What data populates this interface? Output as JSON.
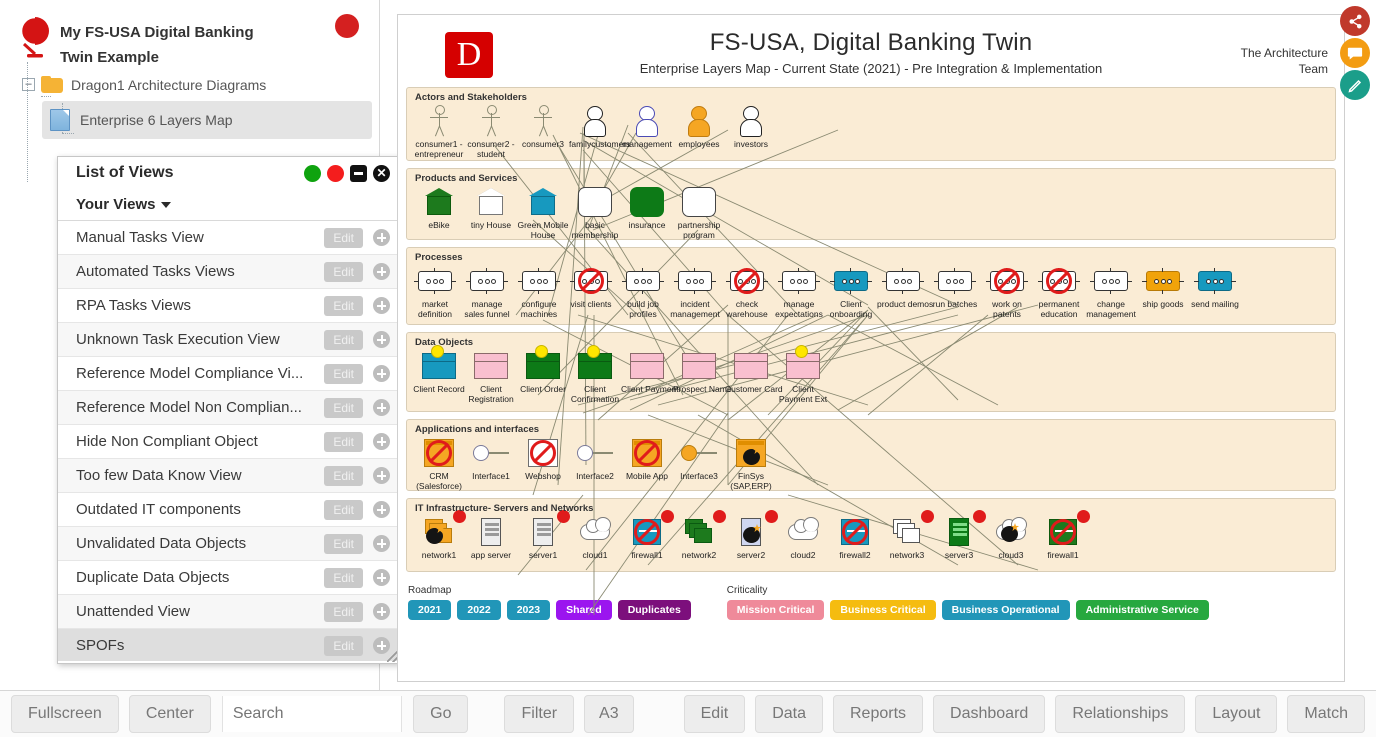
{
  "tree": {
    "root_label": "My FS-USA Digital Banking Twin Example",
    "globe_icon": "globe-icon",
    "folder_label": "Dragon1 Architecture Diagrams",
    "folder_icon": "folder-icon",
    "expander_glyph": "–",
    "doc_label": "Enterprise 6 Layers Map",
    "doc_icon": "document-icon"
  },
  "views_window": {
    "title": "List of Views",
    "subtitle": "Your Views",
    "controls": {
      "green": "green-dot",
      "red": "red-dot",
      "minimize": "minimize",
      "close": "✕"
    },
    "edit_label": "Edit",
    "add_label": "+",
    "items": [
      {
        "label": "Manual Tasks View",
        "selected": false
      },
      {
        "label": "Automated Tasks Views",
        "selected": false
      },
      {
        "label": "RPA Tasks Views",
        "selected": false
      },
      {
        "label": "Unknown Task Execution View",
        "selected": false
      },
      {
        "label": "Reference Model Compliance Vi...",
        "selected": false
      },
      {
        "label": "Reference Model Non Complian...",
        "selected": false
      },
      {
        "label": "Hide Non Compliant Object",
        "selected": false
      },
      {
        "label": "Too few Data Know View",
        "selected": false
      },
      {
        "label": "Outdated IT components",
        "selected": false
      },
      {
        "label": "Unvalidated Data Objects",
        "selected": false
      },
      {
        "label": "Duplicate Data Objects",
        "selected": false
      },
      {
        "label": "Unattended View",
        "selected": false
      },
      {
        "label": "SPOFs",
        "selected": true
      }
    ]
  },
  "diagram": {
    "logo_letter": "D",
    "title": "FS-USA, Digital Banking Twin",
    "subtitle": "Enterprise Layers Map - Current State (2021) - Pre Integration & Implementation",
    "team": "The Architecture Team",
    "bands": [
      {
        "label": "Actors and Stakeholders",
        "nodes": [
          {
            "caption": "consumer1 - entrepreneur",
            "shape": "stick"
          },
          {
            "caption": "consumer2 - student",
            "shape": "stick"
          },
          {
            "caption": "consumer3",
            "shape": "stick"
          },
          {
            "caption": "familycustomers",
            "shape": "person-white"
          },
          {
            "caption": "management",
            "shape": "person-blue"
          },
          {
            "caption": "employees",
            "shape": "person-orange"
          },
          {
            "caption": "investors",
            "shape": "person-white"
          }
        ]
      },
      {
        "label": "Products and Services",
        "nodes": [
          {
            "caption": "eBike",
            "shape": "cube-green"
          },
          {
            "caption": "tiny House",
            "shape": "cube-white"
          },
          {
            "caption": "Green Mobile House",
            "shape": "cube-teal"
          },
          {
            "caption": "basic membership",
            "shape": "rrect-white"
          },
          {
            "caption": "insurance",
            "shape": "rrect-green"
          },
          {
            "caption": "partnership program",
            "shape": "rrect-white"
          }
        ]
      },
      {
        "label": "Processes",
        "nodes": [
          {
            "caption": "market definition",
            "shape": "proc-white"
          },
          {
            "caption": "manage sales funnel",
            "shape": "proc-white"
          },
          {
            "caption": "configure machines",
            "shape": "proc-white"
          },
          {
            "caption": "visit clients",
            "shape": "proc-white",
            "banned": true
          },
          {
            "caption": "build job profiles",
            "shape": "proc-white"
          },
          {
            "caption": "incident management",
            "shape": "proc-white"
          },
          {
            "caption": "check warehouse",
            "shape": "proc-white",
            "banned": true
          },
          {
            "caption": "manage expectations",
            "shape": "proc-white"
          },
          {
            "caption": "Client onboarding",
            "shape": "proc-teal"
          },
          {
            "caption": "product demos",
            "shape": "proc-white"
          },
          {
            "caption": "run batches",
            "shape": "proc-white"
          },
          {
            "caption": "work on patents",
            "shape": "proc-white",
            "banned": true
          },
          {
            "caption": "permanent education",
            "shape": "proc-white",
            "banned": true
          },
          {
            "caption": "change management",
            "shape": "proc-white"
          },
          {
            "caption": "ship goods",
            "shape": "proc-orange"
          },
          {
            "caption": "send mailing",
            "shape": "proc-teal"
          }
        ]
      },
      {
        "label": "Data Objects",
        "nodes": [
          {
            "caption": "Client Record",
            "shape": "dobj-teal",
            "marker": true
          },
          {
            "caption": "Client Registration",
            "shape": "dobj-pink"
          },
          {
            "caption": "Client Order",
            "shape": "dobj-green",
            "marker": true
          },
          {
            "caption": "Client Confirmation",
            "shape": "dobj-green",
            "marker": true
          },
          {
            "caption": "Client Payment",
            "shape": "dobj-pink"
          },
          {
            "caption": "Prospect Name",
            "shape": "dobj-pink"
          },
          {
            "caption": "Customer Card",
            "shape": "dobj-pink"
          },
          {
            "caption": "Client Payment Ext",
            "shape": "dobj-pink",
            "marker": true
          }
        ]
      },
      {
        "label": "Applications and interfaces",
        "nodes": [
          {
            "caption": "CRM (Salesforce)",
            "shape": "app-orange",
            "banned": true
          },
          {
            "caption": "Interface1",
            "shape": "circle-white"
          },
          {
            "caption": "Webshop",
            "shape": "app-white",
            "banned": true
          },
          {
            "caption": "Interface2",
            "shape": "circle-white"
          },
          {
            "caption": "Mobile App",
            "shape": "app-orange",
            "banned": true
          },
          {
            "caption": "Interface3",
            "shape": "circle-orange"
          },
          {
            "caption": "FinSys (SAP,ERP)",
            "shape": "app-bomb"
          }
        ]
      },
      {
        "label": "IT Infrastructure- Servers and Networks",
        "nodes": [
          {
            "caption": "network1",
            "shape": "net-bomb",
            "reddot": true
          },
          {
            "caption": "app server",
            "shape": "server-gray"
          },
          {
            "caption": "server1",
            "shape": "server-gray",
            "reddot": true
          },
          {
            "caption": "cloud1",
            "shape": "cloud"
          },
          {
            "caption": "firewall1",
            "shape": "fw-teal",
            "banned": true,
            "reddot": true
          },
          {
            "caption": "network2",
            "shape": "net-green",
            "reddot": true
          },
          {
            "caption": "server2",
            "shape": "server-bomb",
            "reddot": true
          },
          {
            "caption": "cloud2",
            "shape": "cloud"
          },
          {
            "caption": "firewall2",
            "shape": "fw-teal",
            "banned": true
          },
          {
            "caption": "network3",
            "shape": "net-gray",
            "reddot": true
          },
          {
            "caption": "server3",
            "shape": "server-green",
            "reddot": true
          },
          {
            "caption": "cloud3",
            "shape": "cloud-bomb"
          },
          {
            "caption": "firewall1",
            "shape": "fw-green",
            "banned": true,
            "reddot": true
          }
        ]
      }
    ],
    "legend": {
      "roadmap_label": "Roadmap",
      "criticality_label": "Criticality",
      "roadmap_chips": [
        {
          "label": "2021",
          "color": "#2196b8"
        },
        {
          "label": "2022",
          "color": "#2196b8"
        },
        {
          "label": "2023",
          "color": "#2196b8"
        },
        {
          "label": "Shared",
          "color": "#9b15ef"
        },
        {
          "label": "Duplicates",
          "color": "#7c0f7c"
        }
      ],
      "criticality_chips": [
        {
          "label": "Mission Critical",
          "color": "#ef8a9a"
        },
        {
          "label": "Business Critical",
          "color": "#f5bc10"
        },
        {
          "label": "Business Operational",
          "color": "#2196b8"
        },
        {
          "label": "Administrative Service",
          "color": "#27a83f"
        }
      ]
    }
  },
  "fabs": [
    {
      "name": "share-icon",
      "glyph": "✦",
      "color": "#c0392b"
    },
    {
      "name": "chat-icon",
      "glyph": "▭",
      "color": "#f39c12"
    },
    {
      "name": "pencil-icon",
      "glyph": "✎",
      "color": "#1b9e8a"
    }
  ],
  "toolbar": {
    "fullscreen": "Fullscreen",
    "center": "Center",
    "search_placeholder": "Search",
    "search_value": "",
    "go": "Go",
    "filter": "Filter",
    "paper_size": "A3",
    "edit": "Edit",
    "data": "Data",
    "reports": "Reports",
    "dashboard": "Dashboard",
    "relationships": "Relationships",
    "layout": "Layout",
    "match": "Match"
  }
}
